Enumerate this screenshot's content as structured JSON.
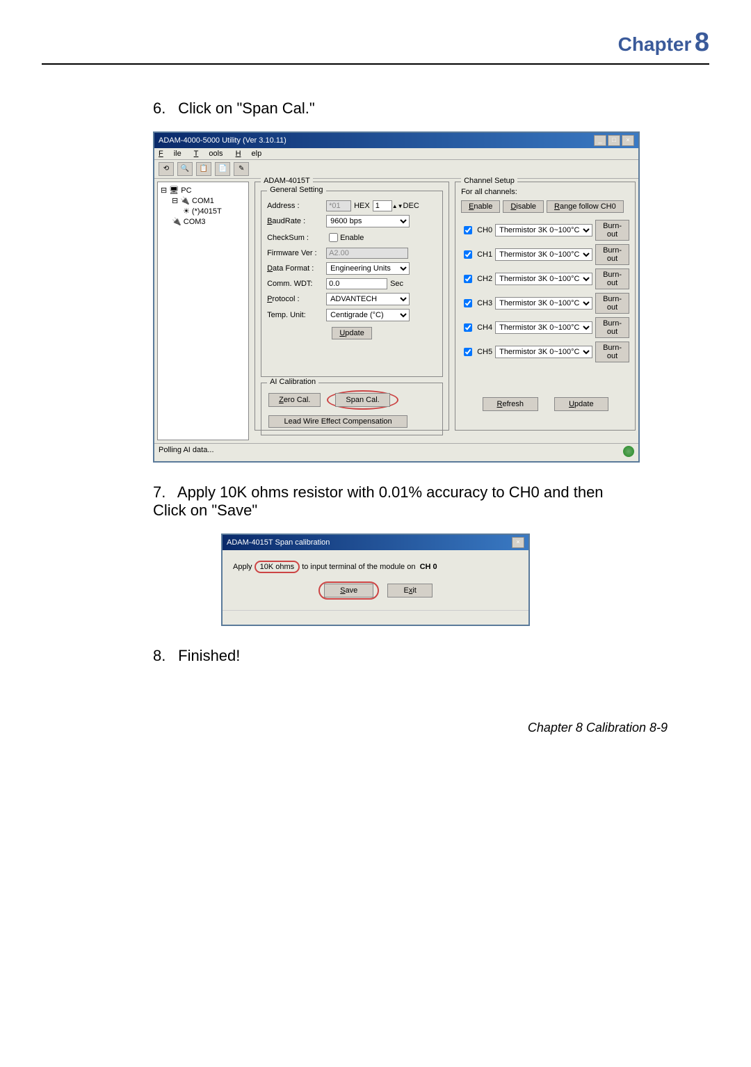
{
  "header": {
    "chapter": "Chapter",
    "num": "8"
  },
  "steps": {
    "s6": {
      "num": "6.",
      "text": "Click on \"Span Cal.\""
    },
    "s7": {
      "num": "7.",
      "text": "Apply 10K ohms resistor with 0.01% accuracy to CH0 and then Click on \"Save\""
    },
    "s8": {
      "num": "8.",
      "text": "Finished!"
    }
  },
  "window": {
    "title": "ADAM-4000-5000 Utility (Ver 3.10.11)",
    "menu": {
      "file": "File",
      "tools": "Tools",
      "help": "Help"
    },
    "tree": {
      "pc": "PC",
      "com1": "COM1",
      "device": "(*)4015T",
      "com3": "COM3"
    },
    "module": "ADAM-4015T",
    "general": {
      "title": "General Setting",
      "address": "Address :",
      "address_hex": "*01",
      "hex": "HEX",
      "dec_val": "1",
      "dec": "DEC",
      "baudrate": "BaudRate :",
      "baudrate_val": "9600 bps",
      "checksum": "CheckSum :",
      "checksum_val": "Enable",
      "firmware": "Firmware Ver :",
      "firmware_val": "A2.00",
      "dataformat": "Data Format :",
      "dataformat_val": "Engineering Units",
      "commwdt": "Comm. WDT:",
      "commwdt_val": "0.0",
      "sec": "Sec",
      "protocol": "Protocol :",
      "protocol_val": "ADVANTECH",
      "tempunit": "Temp. Unit:",
      "tempunit_val": "Centigrade (°C)",
      "update": "Update"
    },
    "aical": {
      "title": "AI Calibration",
      "zero": "Zero Cal.",
      "span": "Span Cal.",
      "leadwire": "Lead Wire Effect Compensation"
    },
    "channel": {
      "title": "Channel Setup",
      "forall": "For all channels:",
      "enable": "Enable",
      "disable": "Disable",
      "range_follow": "Range follow CH0",
      "ch0": "CH0",
      "ch1": "CH1",
      "ch2": "CH2",
      "ch3": "CH3",
      "ch4": "CH4",
      "ch5": "CH5",
      "range": "Thermistor 3K 0~100°C",
      "burnout": "Burn-out",
      "refresh": "Refresh",
      "update": "Update"
    },
    "status": "Polling AI data..."
  },
  "dialog": {
    "title": "ADAM-4015T Span calibration",
    "apply": "Apply",
    "resistor": "10K ohms",
    "text": "to input terminal of the module on",
    "ch": "CH 0",
    "save": "Save",
    "exit": "Exit"
  },
  "footer": "Chapter 8 Calibration 8-9"
}
